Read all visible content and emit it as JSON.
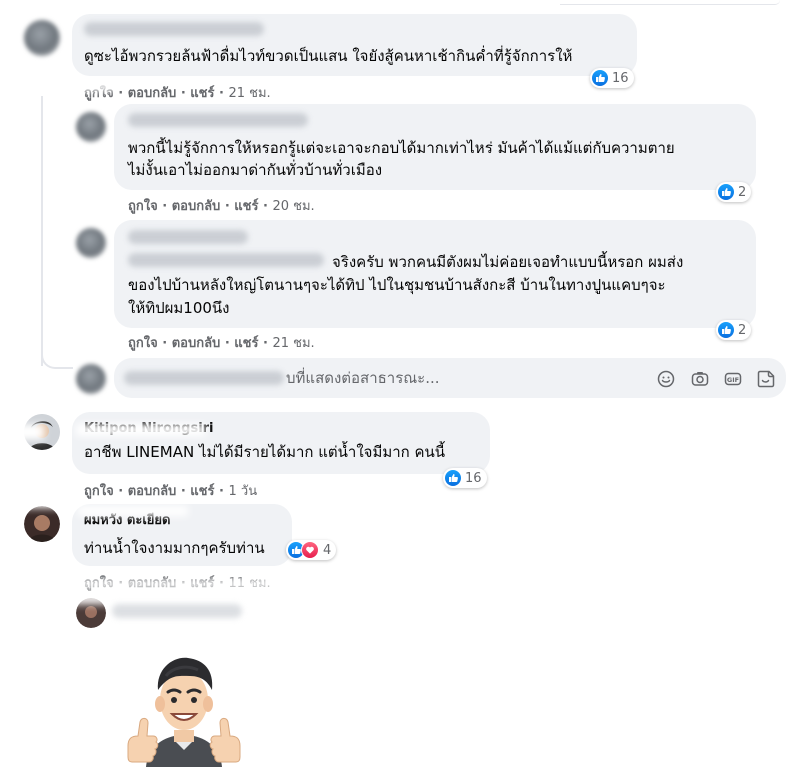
{
  "colors": {
    "bubble": "#f0f2f5",
    "meta": "#65676b",
    "like": "#1877f2",
    "love": "#f33e58"
  },
  "actions": {
    "like": "ถูกใจ",
    "reply": "ตอบกลับ",
    "share": "แชร์"
  },
  "comments": [
    {
      "line1": "ดูซะไอ้พวกรวยล้นฟ้าดื่มไวท์ขวดเป็นแสน ใจยังสู้คนหาเช้ากินค่ำที่รู้จักการให้",
      "meta_like": "ถูกใจ",
      "meta_rest": "· ตอบกลับ · แชร์ ·",
      "time": "21 ชม.",
      "reactions": "16"
    },
    {
      "line1": "พวกนี้ไม่รู้จักการให้หรอกรู้แต่จะเอาจะกอบได้มากเท่าไหร่ มันค้าได้แม้แต่กับความตาย",
      "line2": "ไม่งั้นเอาไม่ออกมาด่ากันทั่วบ้านทั่วเมือง",
      "meta_like": "ถูกใจ",
      "meta_rest": "· ตอบกลับ · แชร์ ·",
      "time": "20 ชม.",
      "reactions": "2"
    },
    {
      "line1": "จริงครับ พวกคนมีตังผมไม่ค่อยเจอทำแบบนี้หรอก ผมส่ง",
      "line2": "ของไปบ้านหลังใหญ่โตนานๆจะได้ทิป ไปในชุมชนบ้านสังกะสี บ้านในทางปูนแคบๆจะ",
      "line3": "ให้ทิปผม100นึง",
      "meta_like": "ถูกใจ",
      "meta_rest": "· ตอบกลับ · แชร์ ·",
      "time": "21 ชม.",
      "reactions": "2"
    },
    {
      "author": "Kitipon Nirongsiri",
      "line1": "อาชีพ LINEMAN ไม่ได้มีรายได้มาก แต่น้ำใจมีมาก คนนี้",
      "meta_like": "ถูกใจ",
      "meta_rest": "· ตอบกลับ · แชร์ ·",
      "time": "1 วัน",
      "reactions": "16"
    },
    {
      "author": "ผมหวัง ตะเยียด",
      "line1": "ท่านน้ำใจงามมากๆครับท่าน",
      "meta_like": "ถูกใจ",
      "meta_rest": "· ตอบกลับ · แชร์ ·",
      "time": "11 ชม.",
      "reactions": "4"
    }
  ],
  "reply_input": {
    "placeholder": "บที่แสดงต่อสาธารณะ..."
  },
  "input_icons": [
    "emoji-icon",
    "camera-icon",
    "gif-icon",
    "sticker-icon"
  ]
}
